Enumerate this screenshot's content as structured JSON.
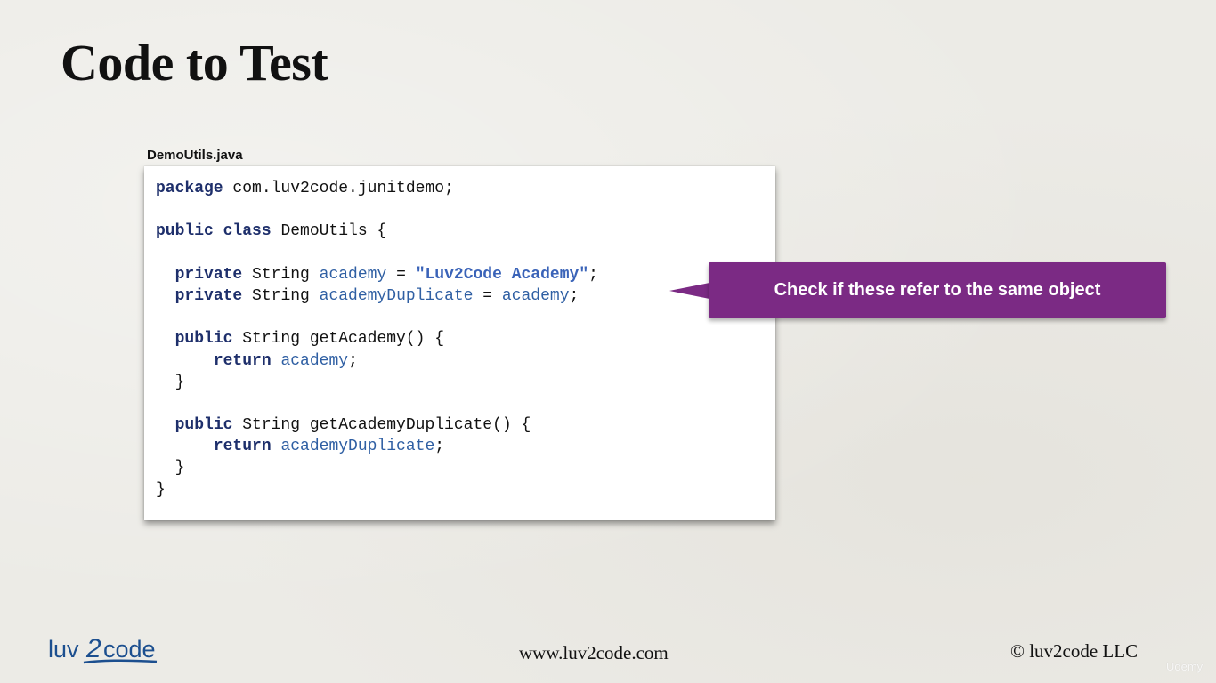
{
  "slide": {
    "title": "Code to Test"
  },
  "file_label": "DemoUtils.java",
  "code": {
    "lines": [
      [
        {
          "t": "package",
          "c": "kw"
        },
        {
          "t": " com.luv2code.junitdemo;",
          "c": "plain"
        }
      ],
      [],
      [
        {
          "t": "public",
          "c": "kw"
        },
        {
          "t": " ",
          "c": "plain"
        },
        {
          "t": "class",
          "c": "kw"
        },
        {
          "t": " DemoUtils {",
          "c": "plain"
        }
      ],
      [],
      [
        {
          "t": "  ",
          "c": "plain"
        },
        {
          "t": "private",
          "c": "kw"
        },
        {
          "t": " String ",
          "c": "plain"
        },
        {
          "t": "academy",
          "c": "field"
        },
        {
          "t": " = ",
          "c": "plain"
        },
        {
          "t": "\"Luv2Code Academy\"",
          "c": "str"
        },
        {
          "t": ";",
          "c": "plain"
        }
      ],
      [
        {
          "t": "  ",
          "c": "plain"
        },
        {
          "t": "private",
          "c": "kw"
        },
        {
          "t": " String ",
          "c": "plain"
        },
        {
          "t": "academyDuplicate",
          "c": "field"
        },
        {
          "t": " = ",
          "c": "plain"
        },
        {
          "t": "academy",
          "c": "field"
        },
        {
          "t": ";",
          "c": "plain"
        }
      ],
      [],
      [
        {
          "t": "  ",
          "c": "plain"
        },
        {
          "t": "public",
          "c": "kw"
        },
        {
          "t": " String getAcademy() {",
          "c": "plain"
        }
      ],
      [
        {
          "t": "      ",
          "c": "plain"
        },
        {
          "t": "return",
          "c": "kw"
        },
        {
          "t": " ",
          "c": "plain"
        },
        {
          "t": "academy",
          "c": "field"
        },
        {
          "t": ";",
          "c": "plain"
        }
      ],
      [
        {
          "t": "  }",
          "c": "plain"
        }
      ],
      [],
      [
        {
          "t": "  ",
          "c": "plain"
        },
        {
          "t": "public",
          "c": "kw"
        },
        {
          "t": " String getAcademyDuplicate() {",
          "c": "plain"
        }
      ],
      [
        {
          "t": "      ",
          "c": "plain"
        },
        {
          "t": "return",
          "c": "kw"
        },
        {
          "t": " ",
          "c": "plain"
        },
        {
          "t": "academyDuplicate",
          "c": "field"
        },
        {
          "t": ";",
          "c": "plain"
        }
      ],
      [
        {
          "t": "  }",
          "c": "plain"
        }
      ],
      [
        {
          "t": "}",
          "c": "plain"
        }
      ]
    ]
  },
  "callout": {
    "text": "Check if these refer to the same object"
  },
  "footer": {
    "logo_text_left": "luv",
    "logo_text_mid": "2",
    "logo_text_right": "code",
    "url": "www.luv2code.com",
    "copyright": "© luv2code LLC",
    "watermark": "Udemy"
  },
  "colors": {
    "background": "#ecebe6",
    "keyword": "#1e2f6b",
    "field": "#2f5fa3",
    "string": "#3a63b8",
    "callout": "#7b2a84",
    "logo_blue": "#1c4f8f"
  },
  "icons": {
    "logo": "luv2code-logo"
  }
}
